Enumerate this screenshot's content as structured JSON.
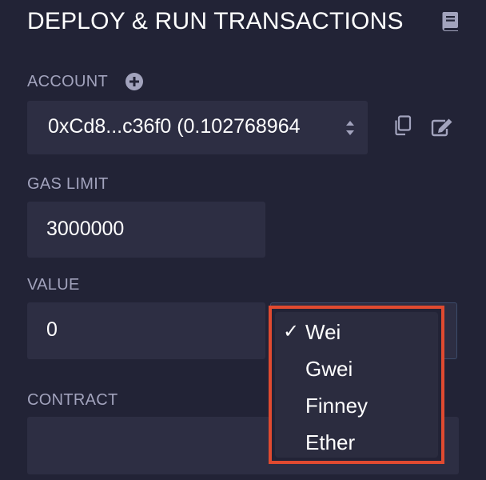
{
  "header": {
    "title": "DEPLOY & RUN TRANSACTIONS",
    "doc_icon": "book-icon"
  },
  "account": {
    "label": "ACCOUNT",
    "add_icon": "plus-circle-icon",
    "selected": "0xCd8...c36f0 (0.102768964",
    "copy_icon": "copy-icon",
    "edit_icon": "edit-icon"
  },
  "gas_limit": {
    "label": "GAS LIMIT",
    "value": "3000000"
  },
  "value": {
    "label": "VALUE",
    "amount": "0",
    "unit_options": [
      {
        "label": "Wei",
        "selected": true
      },
      {
        "label": "Gwei",
        "selected": false
      },
      {
        "label": "Finney",
        "selected": false
      },
      {
        "label": "Ether",
        "selected": false
      }
    ],
    "check_mark": "✓",
    "highlight_color": "#e04a30"
  },
  "contract": {
    "label": "CONTRACT",
    "selected": ""
  },
  "colors": {
    "background": "#222336",
    "field": "#2d2e43",
    "label": "#a2a3bd"
  }
}
